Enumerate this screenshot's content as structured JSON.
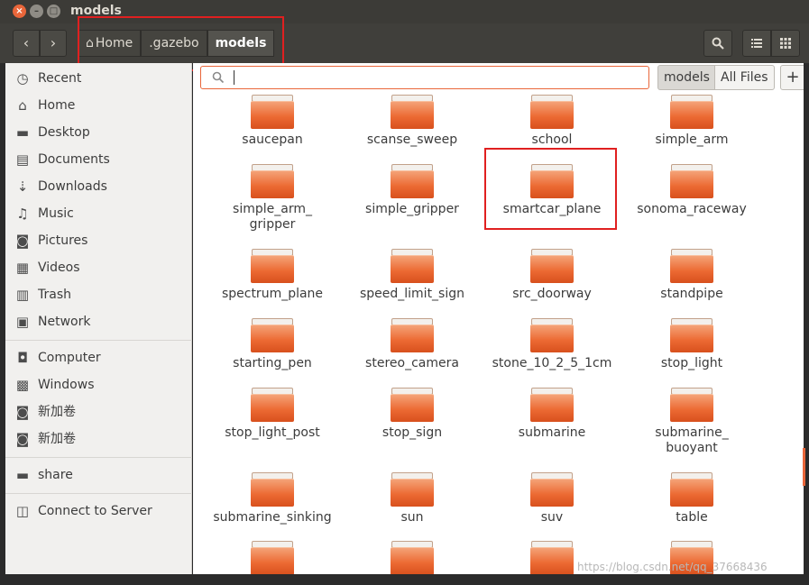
{
  "window": {
    "title": "models"
  },
  "toolbar": {
    "back_icon": "‹",
    "forward_icon": "›",
    "breadcrumbs": [
      "Home",
      ".gazebo",
      "models"
    ],
    "search_icon": "search-icon",
    "list_view_icon": "list-icon",
    "grid_view_icon": "grid-icon"
  },
  "sidebar": {
    "items": [
      {
        "label": "Recent",
        "icon": "clock-icon"
      },
      {
        "label": "Home",
        "icon": "home-icon"
      },
      {
        "label": "Desktop",
        "icon": "folder-icon"
      },
      {
        "label": "Documents",
        "icon": "document-icon"
      },
      {
        "label": "Downloads",
        "icon": "download-icon"
      },
      {
        "label": "Music",
        "icon": "music-icon"
      },
      {
        "label": "Pictures",
        "icon": "camera-icon"
      },
      {
        "label": "Videos",
        "icon": "film-icon"
      },
      {
        "label": "Trash",
        "icon": "trash-icon"
      },
      {
        "label": "Network",
        "icon": "network-icon"
      },
      {
        "label": "Computer",
        "icon": "drive-icon"
      },
      {
        "label": "Windows",
        "icon": "drive-icon"
      },
      {
        "label": "新加卷",
        "icon": "drive-icon"
      },
      {
        "label": "新加卷",
        "icon": "drive-icon"
      },
      {
        "label": "share",
        "icon": "folder-icon"
      },
      {
        "label": "Connect to Server",
        "icon": "server-icon"
      }
    ]
  },
  "search": {
    "value": "",
    "placeholder": ""
  },
  "scope": {
    "models": "models",
    "all_files": "All Files",
    "add": "+"
  },
  "files": [
    "saucepan",
    "scanse_sweep",
    "school",
    "simple_arm",
    "simple_arm_\ngripper",
    "simple_gripper",
    "smartcar_plane",
    "sonoma_raceway",
    "spectrum_plane",
    "speed_limit_sign",
    "src_doorway",
    "standpipe",
    "starting_pen",
    "stereo_camera",
    "stone_10_2_5_1cm",
    "stop_light",
    "stop_light_post",
    "stop_sign",
    "submarine",
    "submarine_\nbuoyant",
    "submarine_sinking",
    "sun",
    "suv",
    "table"
  ],
  "watermark": "https://blog.csdn.net/qq_37668436",
  "colors": {
    "accent": "#e9663a",
    "highlight": "#e02020"
  }
}
